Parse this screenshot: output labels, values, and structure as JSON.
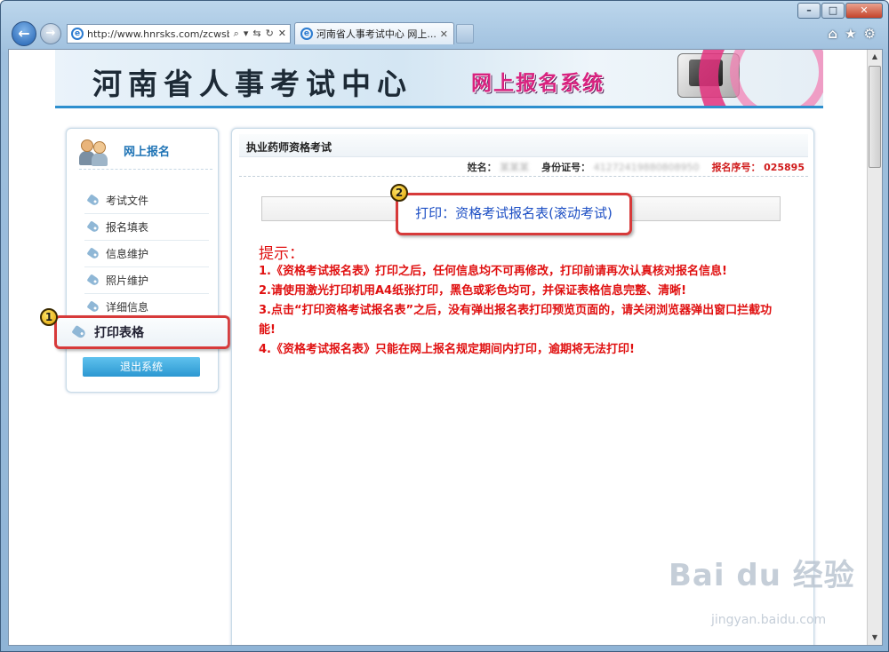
{
  "window": {
    "minimize": "–",
    "maximize": "□",
    "close": "✕"
  },
  "browser": {
    "address": "http://www.hnrsks.com/zcwsb",
    "address_tools": [
      "⌕",
      "▾",
      "⇆",
      "↻",
      "✕"
    ],
    "tab_title": "河南省人事考试中心 网上...",
    "tab_close": "✕",
    "icons": [
      "⌂",
      "★",
      "⚙"
    ]
  },
  "banner": {
    "title": "河南省人事考试中心",
    "system": "网上报名系统"
  },
  "sidebar": {
    "header": "网上报名",
    "items": [
      {
        "label": "考试文件"
      },
      {
        "label": "报名填表"
      },
      {
        "label": "信息维护"
      },
      {
        "label": "照片维护"
      },
      {
        "label": "详细信息"
      }
    ],
    "print_item": "打印表格",
    "logout": "退出系统",
    "badge": "1"
  },
  "main": {
    "title": "执业药师资格考试",
    "name_label": "姓名：",
    "name_value": "某某某",
    "id_label": "身份证号：",
    "id_value": "41272419880808950",
    "serial_label": "报名序号：",
    "serial_value": "025895",
    "print_link": "打印：资格考试报名表(滚动考试)",
    "badge": "2",
    "tips_title": "提示：",
    "tips": [
      "1.《资格考试报名表》打印之后，任何信息均不可再修改，打印前请再次认真核对报名信息!",
      "2.请使用激光打印机用A4纸张打印，黑色或彩色均可，并保证表格信息完整、清晰!",
      "3.点击“打印资格考试报名表”之后，没有弹出报名表打印预览页面的，请关闭浏览器弹出窗口拦截功能!",
      "4.《资格考试报名表》只能在网上报名规定期间内打印，逾期将无法打印!"
    ]
  },
  "watermark": {
    "brand": "Bai du 经验",
    "url": "jingyan.baidu.com"
  }
}
